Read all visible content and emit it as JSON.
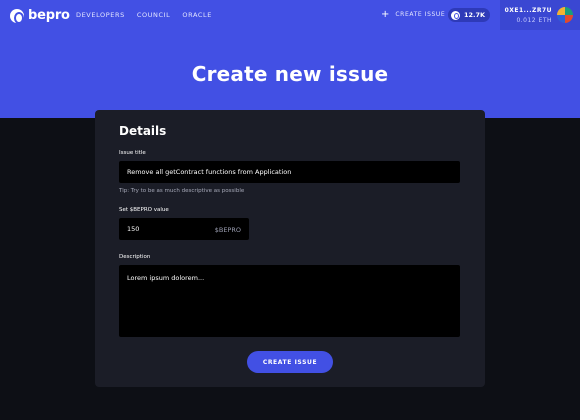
{
  "brand": {
    "name": "bepro",
    "icon": "bepro-logo-icon"
  },
  "nav": {
    "items": [
      {
        "label": "DEVELOPERS"
      },
      {
        "label": "COUNCIL"
      },
      {
        "label": "ORACLE"
      }
    ],
    "create_issue_label": "CREATE ISSUE",
    "balance": "12.7K",
    "wallet": {
      "address": "0XE1...ZR7U",
      "balance": "0.012 ETH"
    }
  },
  "page": {
    "title": "Create new issue"
  },
  "form": {
    "heading": "Details",
    "issue_title": {
      "label": "Issue title",
      "value": "Remove all getContract functions from Application",
      "tip": "Tip: Try to be as much descriptive as possible"
    },
    "bepro_value": {
      "label": "Set $BEPRO value",
      "value": "150",
      "suffix": "$BEPRO"
    },
    "description": {
      "label": "Description",
      "value": "Lorem ipsum dolorem..."
    },
    "submit_label": "CREATE ISSUE"
  },
  "colors": {
    "accent": "#4250e4",
    "background": "#0d0f15",
    "card": "#1b1d27",
    "input": "#000000"
  }
}
